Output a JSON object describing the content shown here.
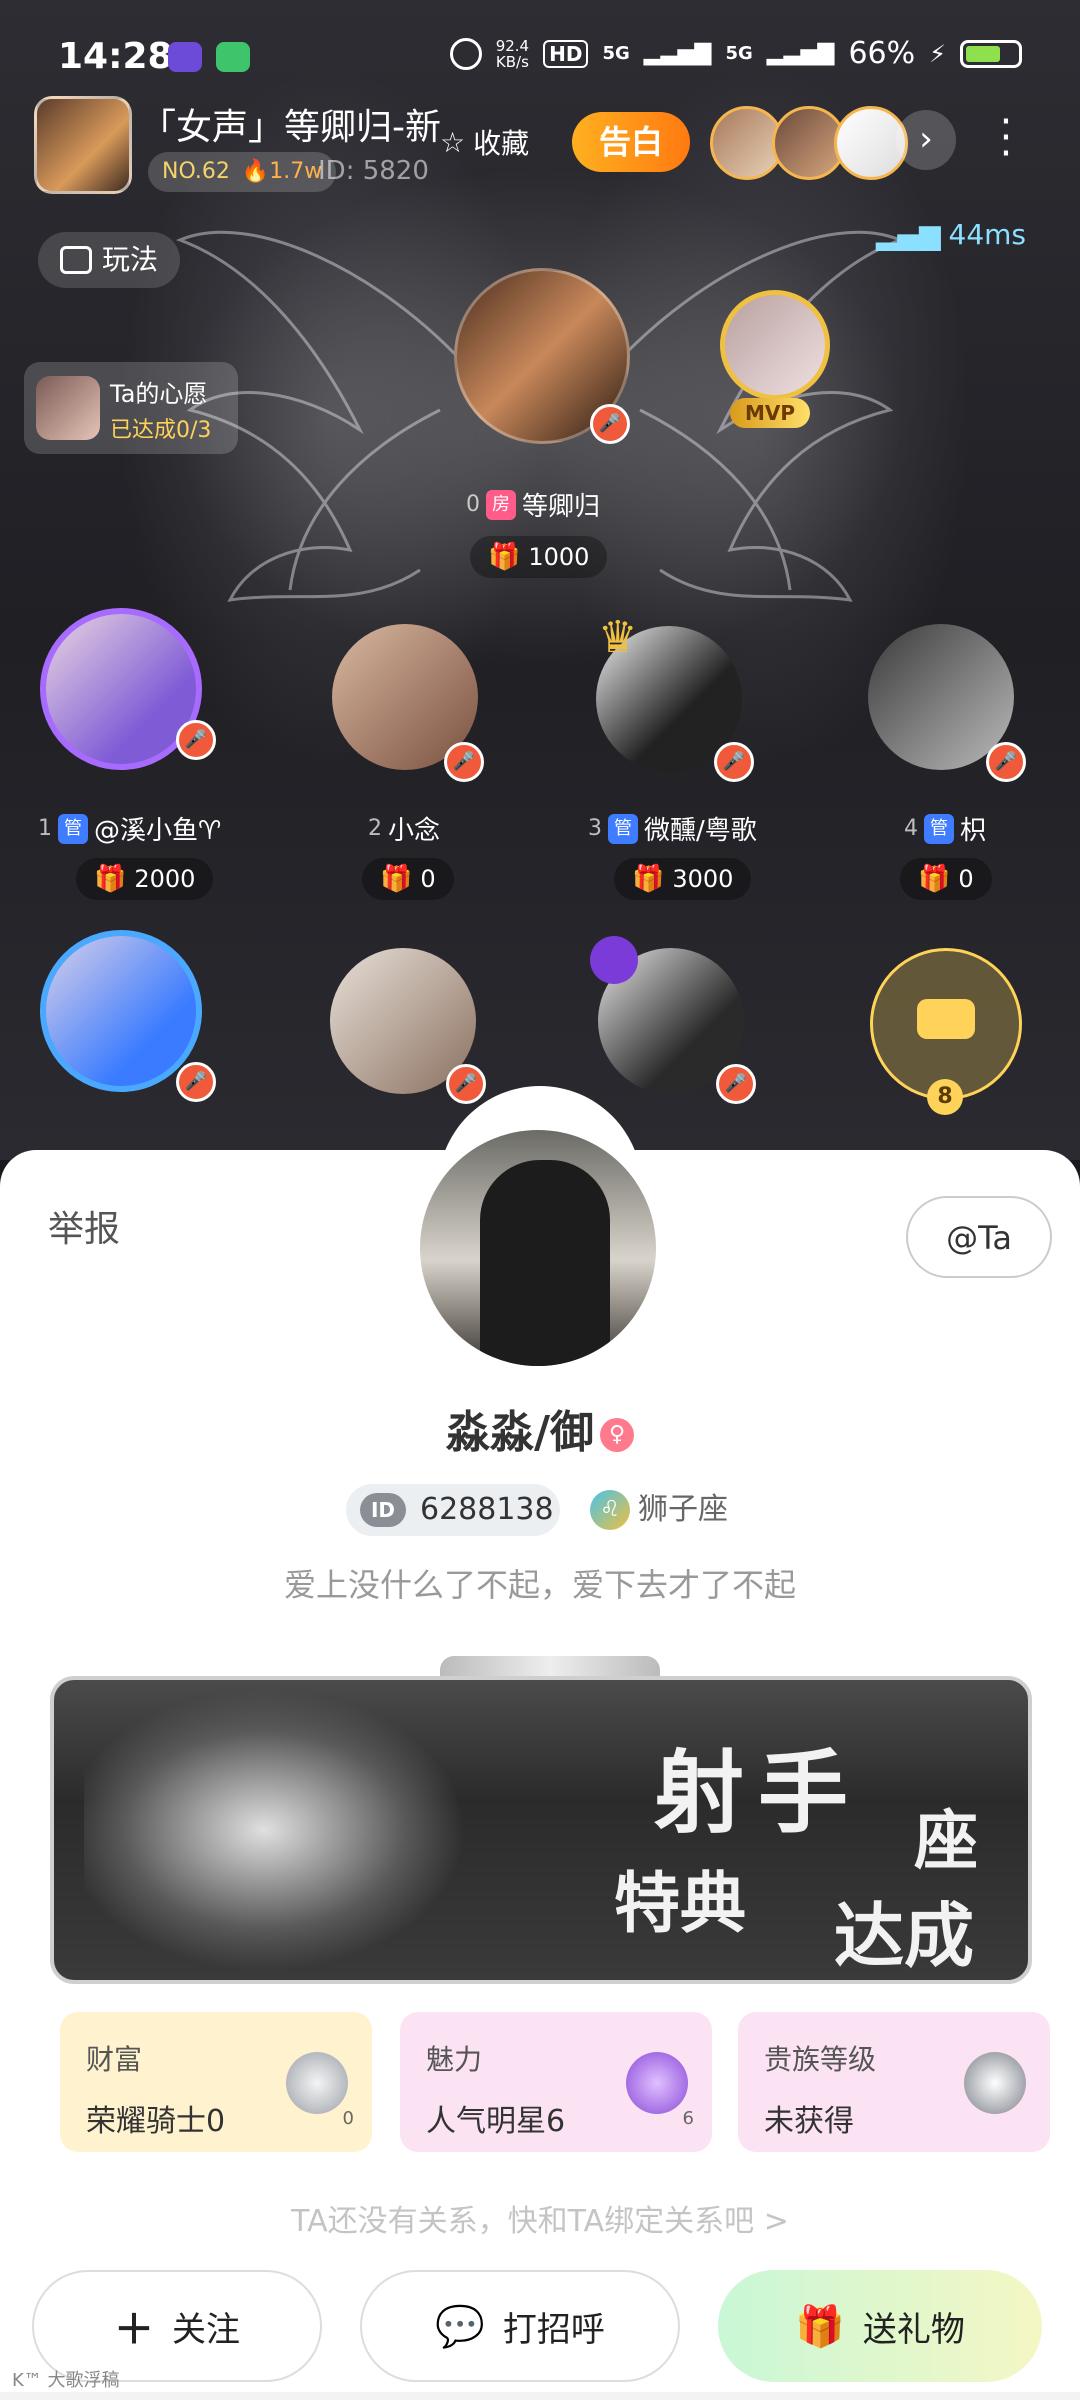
{
  "status_bar": {
    "time": "14:28",
    "net_speed": "92.4",
    "net_unit": "KB/s",
    "hd": "HD",
    "signal1": "5G",
    "signal2": "5G",
    "battery": "66%",
    "icons": [
      "app-icon-1",
      "app-icon-2",
      "alarm-icon",
      "battery-icon"
    ]
  },
  "room": {
    "title": "「女声」等卿归-新",
    "rank": "NO.62",
    "hot": "1.7w",
    "id": "ID: 5820",
    "favorite": "收藏",
    "confess": "告白",
    "ping": "44ms",
    "play": "玩法",
    "wish_title": "Ta的心愿",
    "wish_status": "已达成0/3"
  },
  "host": {
    "index": "0",
    "tag": "房",
    "name": "等卿归",
    "gift": "1000",
    "mvp": "MVP"
  },
  "seats": [
    {
      "index": "1",
      "tag": "管",
      "name": "@溪小鱼♈",
      "gift": "2000"
    },
    {
      "index": "2",
      "tag": "",
      "name": "小念",
      "gift": "0"
    },
    {
      "index": "3",
      "tag": "管",
      "name": "微醺/粤歌",
      "gift": "3000"
    },
    {
      "index": "4",
      "tag": "管",
      "name": "枳",
      "gift": "0"
    }
  ],
  "empty_seat_count": "8",
  "profile": {
    "report": "举报",
    "at_ta": "@Ta",
    "name": "淼淼/御",
    "gender_icon": "female-icon",
    "id_label": "ID",
    "id": "6288138",
    "zodiac": "狮子座",
    "bio": "爱上没什么了不起，爱下去才了不起",
    "banner": {
      "line1": "射手",
      "line2": "座",
      "line3": "特典",
      "line4": "达成"
    },
    "stats": [
      {
        "label": "财富",
        "value": "荣耀骑士0",
        "icon_label": "0"
      },
      {
        "label": "魅力",
        "value": "人气明星6",
        "icon_label": "6"
      },
      {
        "label": "贵族等级",
        "value": "未获得",
        "icon_label": ""
      }
    ],
    "relation": "TA还没有关系，快和TA绑定关系吧 >",
    "buttons": {
      "follow": "关注",
      "greet": "打招呼",
      "gift": "送礼物"
    }
  },
  "watermark": "K™ 大歌浮稿",
  "colors": {
    "accent": "#ff8a14",
    "mic": "#f05a3a",
    "admin_tag": "#3f7cff",
    "room_tag": "#ff5c8a"
  }
}
